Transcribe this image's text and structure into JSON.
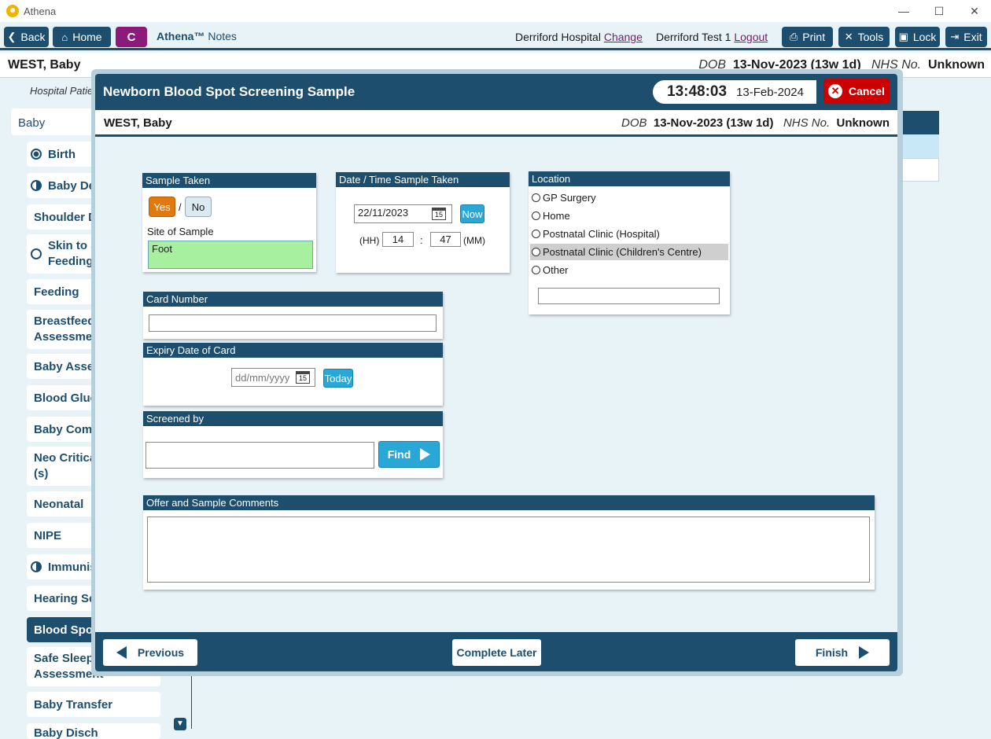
{
  "window": {
    "title": "Athena",
    "minimize": "—",
    "maximize": "☐",
    "close": "✕"
  },
  "nav": {
    "back": "Back",
    "home": "Home",
    "c": "C",
    "brand": "Athena™",
    "brand_suffix": "Notes",
    "hospital": "Derriford Hospital",
    "change": "Change",
    "user": "Derriford Test 1",
    "logout": "Logout",
    "print": "Print",
    "tools": "Tools",
    "lock": "Lock",
    "exit": "Exit"
  },
  "patient": {
    "name": "WEST, Baby",
    "dob_label": "DOB",
    "dob": "13-Nov-2023 (13w 1d)",
    "nhs_label": "NHS No.",
    "nhs": "Unknown"
  },
  "hospital_patient": "Hospital Patie",
  "sidebar": {
    "header": "Baby",
    "items": [
      {
        "label": "Birth"
      },
      {
        "label": "Baby Dev"
      },
      {
        "label": "Shoulder D"
      },
      {
        "label": "Skin to S",
        "label2": "Feeding"
      },
      {
        "label": "Feeding"
      },
      {
        "label": "Breastfeedi",
        "label2": "Assessmen"
      },
      {
        "label": "Baby Asses"
      },
      {
        "label": "Blood Gluc"
      },
      {
        "label": "Baby Comr"
      },
      {
        "label": "Neo Critica",
        "label2": "(s)"
      },
      {
        "label": "Neonatal"
      },
      {
        "label": "NIPE"
      },
      {
        "label": "Immunis"
      },
      {
        "label": "Hearing Sc"
      },
      {
        "label": "Blood Spot"
      },
      {
        "label": "Safe Sleepi",
        "label2": "Assessment"
      },
      {
        "label": "Baby Transfer"
      },
      {
        "label": "Baby Disch"
      }
    ]
  },
  "modal": {
    "title": "Newborn Blood Spot Screening Sample",
    "time": "13:48:03",
    "date": "13-Feb-2024",
    "cancel": "Cancel",
    "sample_taken": {
      "header": "Sample Taken",
      "yes": "Yes",
      "slash": "/",
      "no": "No",
      "site_label": "Site of Sample",
      "site_value": "Foot"
    },
    "datetime": {
      "header": "Date / Time Sample Taken",
      "date_value": "22/11/2023",
      "cal_num": "15",
      "now": "Now",
      "hh_label": "(HH)",
      "hh": "14",
      "colon": ":",
      "mm": "47",
      "mm_label": "(MM)"
    },
    "location": {
      "header": "Location",
      "options": [
        "GP Surgery",
        "Home",
        "Postnatal Clinic (Hospital)",
        "Postnatal Clinic (Children's Centre)",
        "Other"
      ]
    },
    "card_number": {
      "header": "Card Number",
      "value": ""
    },
    "expiry": {
      "header": "Expiry Date of Card",
      "placeholder": "dd/mm/yyyy",
      "cal_num": "15",
      "today": "Today"
    },
    "screened_by": {
      "header": "Screened by",
      "value": "",
      "find": "Find"
    },
    "comments": {
      "header": "Offer and Sample Comments",
      "value": ""
    },
    "footer": {
      "previous": "Previous",
      "complete_later": "Complete Later",
      "finish": "Finish"
    }
  }
}
